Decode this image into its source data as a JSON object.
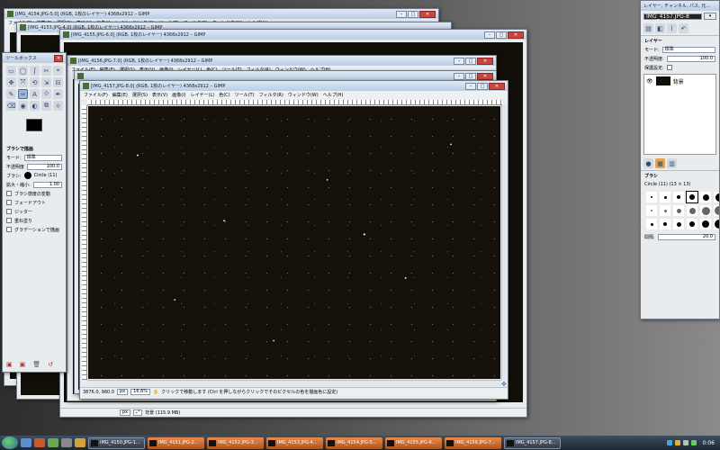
{
  "windows": {
    "w1_title": "[IMG_4154.JPG-5.0] (RGB, 1枚のレイヤー) 4368x2912 – GIMP",
    "w2_title": "[IMG_4153.JPG-4.0] (RGB, 1枚のレイヤー) 4368x2912 – GIMP",
    "w3_title": "[IMG_4155.JPG-6.0] (RGB, 1枚のレイヤー) 4368x2912 – GIMP",
    "w4_title": "[IMG_4156.JPG-7.0] (RGB, 1枚のレイヤー) 4368x2912 – GIMP",
    "w5_title": "[IMG_4157.JPG-8.0] (RGB, 1枚のレイヤー) 4368x2912 – GIMP"
  },
  "menu": [
    "ファイル(F)",
    "編集(E)",
    "選択(S)",
    "表示(V)",
    "画像(I)",
    "レイヤー(L)",
    "色(C)",
    "ツール(T)",
    "フィルタ(R)",
    "ウィンドウ(W)",
    "ヘルプ(H)"
  ],
  "front_window": {
    "coords": "3876.0, 980.0",
    "unit": "px",
    "zoom": "16.6%",
    "status": "クリックで移動します (Ctrl を押しながらクリックでそのピクセルの色を描画色に設定)"
  },
  "back_window": {
    "unit": "px",
    "status": "背景 (115.9 MB)"
  },
  "toolbox": {
    "title": "ツールボックス",
    "tools": [
      "▭",
      "◯",
      "ʃ",
      "✂",
      "⌖",
      "✥",
      "⤧",
      "⟲",
      "⇲",
      "⊟",
      "✎",
      "✑",
      "A",
      "⟐",
      "✒",
      "⌫",
      "◉",
      "◐",
      "⧉",
      "☼"
    ],
    "section": "ブラシで描画",
    "mode_label": "モード:",
    "mode_value": "標準",
    "opacity_label": "不透明度",
    "opacity_value": "100.0",
    "brush_label": "ブラシ:",
    "brush_value": "Circle (11)",
    "scale_label": "拡大・縮小:",
    "scale_value": "1.00",
    "options": [
      "ブラシ感度の変動",
      "フェードアウト",
      "ジッター",
      "重ね塗り",
      "グラデーションで描画"
    ]
  },
  "dock": {
    "title": "レイヤー, チャンネル, パス, 元...",
    "image_select": "IMG_4157.JPG-8",
    "layers_header": "レイヤー",
    "mode_label": "モード:",
    "mode_value": "標準",
    "opacity_label": "不透明度:",
    "opacity_value": "100.0",
    "lock_label": "保護設定:",
    "layer_name": "背景",
    "brushes_header": "ブラシ",
    "brush_name": "Circle (11) (13 × 13)",
    "spacing_label": "間隔:",
    "spacing_value": "20.0"
  },
  "taskbar": {
    "tasks": [
      {
        "label": "IMG_4150.JPG-1...",
        "state": "current"
      },
      {
        "label": "IMG_4151.JPG-2...",
        "state": "inactive"
      },
      {
        "label": "IMG_4152.JPG-3...",
        "state": "inactive"
      },
      {
        "label": "IMG_4153.JPG-4...",
        "state": "inactive"
      },
      {
        "label": "IMG_4154.JPG-5...",
        "state": "inactive"
      },
      {
        "label": "IMG_4155.JPG-6...",
        "state": "inactive"
      },
      {
        "label": "IMG_4156.JPG-7...",
        "state": "inactive"
      },
      {
        "label": "IMG_4157.JPG-8...",
        "state": "current"
      }
    ],
    "clock": "0:06"
  },
  "colors": {
    "accent_task": "#e07a3a",
    "canvas": "#15110a",
    "toolbar_active": "#9fb6d3"
  }
}
